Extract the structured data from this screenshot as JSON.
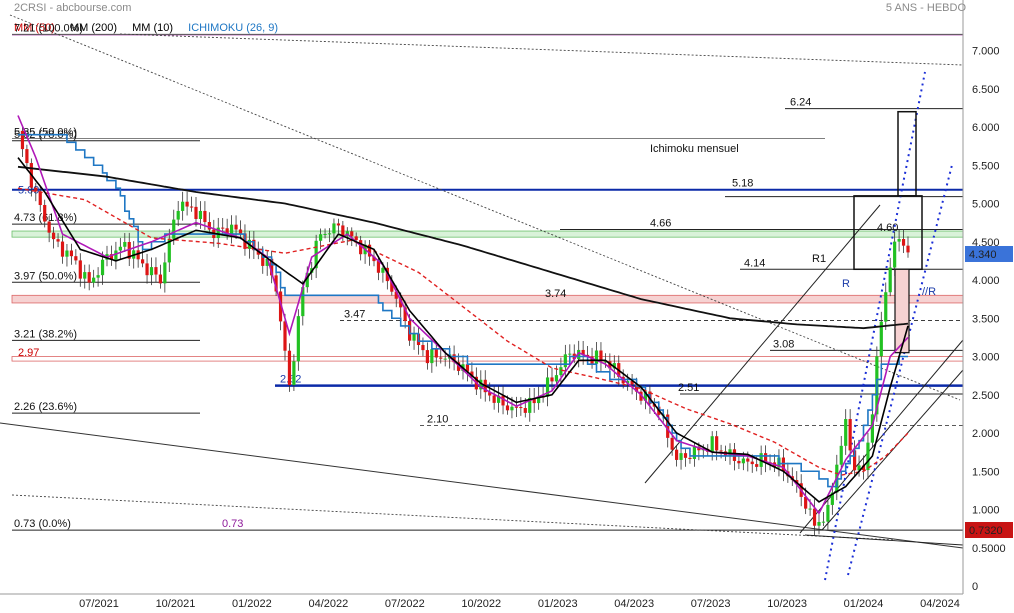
{
  "header": {
    "symbol": "2CRSI - abcbourse.com",
    "period": "5 ANS - HEBDO"
  },
  "legend": {
    "items": [
      {
        "label": "MM (50)",
        "color": "#cc0000"
      },
      {
        "label": "MM (200)",
        "color": "#000000"
      },
      {
        "label": "MM (10)",
        "color": "#000000"
      },
      {
        "label": "ICHIMOKU (26, 9)",
        "color": "#1f77c4"
      }
    ]
  },
  "colors": {
    "up": "#22c122",
    "down": "#dd1515",
    "blue_level": "#0b2aa8",
    "kijun": "#1f77c4",
    "tenkan": "#b018b8"
  },
  "annotations": {
    "ichimoku": "Ichimoku mensuel",
    "r1": "R1",
    "r": "R",
    "parallel_r": "//R"
  },
  "price_labels": {
    "current": "4.340",
    "low": "0.7320"
  },
  "chart_data": {
    "type": "candlestick",
    "x_ticks": [
      "07/2021",
      "10/2021",
      "01/2022",
      "04/2022",
      "07/2022",
      "10/2022",
      "01/2023",
      "04/2023",
      "07/2023",
      "10/2023",
      "01/2024",
      "04/2024"
    ],
    "y_ticks": [
      "0",
      "0.5000",
      "1.000",
      "1.500",
      "2.000",
      "2.500",
      "3.000",
      "3.500",
      "4.000",
      "4.500",
      "5.000",
      "5.500",
      "6.000",
      "6.500",
      "7.000"
    ],
    "ylim": [
      0,
      7.3
    ],
    "last_price": 4.34,
    "low_price": 0.732,
    "fib_levels": [
      {
        "label": "7.21  (100.0%)",
        "value": 7.21
      },
      {
        "label": "5.85  (50.0%)",
        "value": 5.85
      },
      {
        "label": "5.82  (78.6%)",
        "value": 5.82
      },
      {
        "label": "4.73  (61.8%)",
        "value": 4.73
      },
      {
        "label": "3.97  (50.0%)",
        "value": 3.97
      },
      {
        "label": "3.21  (38.2%)",
        "value": 3.21
      },
      {
        "label": "2.26  (23.6%)",
        "value": 2.26
      },
      {
        "label": "0.73  (0.0%)",
        "value": 0.73
      }
    ],
    "levels": [
      {
        "label": "6.24",
        "value": 6.24
      },
      {
        "label": "5.18",
        "value": 5.18
      },
      {
        "label": "5.09",
        "value": 5.09
      },
      {
        "label": "4.66",
        "value": 4.66
      },
      {
        "label": "4.60",
        "value": 4.6
      },
      {
        "label": "4.14",
        "value": 4.14
      },
      {
        "label": "3.74",
        "value": 3.74
      },
      {
        "label": "3.47",
        "value": 3.47
      },
      {
        "label": "3.08",
        "value": 3.08
      },
      {
        "label": "2.97",
        "value": 2.97
      },
      {
        "label": "2.62",
        "value": 2.62
      },
      {
        "label": "2.51",
        "value": 2.51
      },
      {
        "label": "2.10",
        "value": 2.1
      },
      {
        "label": "0.73",
        "value": 0.73
      }
    ],
    "close_keyframes": [
      [
        0,
        5.9
      ],
      [
        4,
        5.1
      ],
      [
        8,
        4.5
      ],
      [
        12,
        4.3
      ],
      [
        16,
        3.95
      ],
      [
        20,
        4.3
      ],
      [
        24,
        4.45
      ],
      [
        28,
        4.2
      ],
      [
        32,
        4.0
      ],
      [
        36,
        5.0
      ],
      [
        40,
        4.9
      ],
      [
        44,
        4.6
      ],
      [
        48,
        4.7
      ],
      [
        52,
        4.45
      ],
      [
        56,
        4.2
      ],
      [
        58,
        3.9
      ],
      [
        61,
        2.6
      ],
      [
        64,
        3.9
      ],
      [
        68,
        4.6
      ],
      [
        72,
        4.7
      ],
      [
        76,
        4.5
      ],
      [
        80,
        4.25
      ],
      [
        84,
        3.9
      ],
      [
        88,
        3.3
      ],
      [
        92,
        3.0
      ],
      [
        96,
        3.0
      ],
      [
        100,
        2.85
      ],
      [
        104,
        2.6
      ],
      [
        108,
        2.4
      ],
      [
        112,
        2.3
      ],
      [
        116,
        2.4
      ],
      [
        120,
        2.7
      ],
      [
        124,
        3.05
      ],
      [
        128,
        3.0
      ],
      [
        132,
        2.95
      ],
      [
        136,
        2.7
      ],
      [
        140,
        2.5
      ],
      [
        144,
        2.3
      ],
      [
        148,
        1.65
      ],
      [
        152,
        1.75
      ],
      [
        156,
        1.85
      ],
      [
        160,
        1.7
      ],
      [
        164,
        1.6
      ],
      [
        168,
        1.65
      ],
      [
        172,
        1.55
      ],
      [
        176,
        1.2
      ],
      [
        179,
        0.8
      ],
      [
        182,
        0.95
      ],
      [
        184,
        1.6
      ],
      [
        186,
        2.1
      ],
      [
        188,
        1.55
      ],
      [
        190,
        1.5
      ],
      [
        192,
        2.3
      ],
      [
        194,
        3.5
      ],
      [
        196,
        4.2
      ],
      [
        198,
        4.6
      ],
      [
        200,
        4.34
      ]
    ],
    "mm200_keyframes": [
      [
        0,
        5.48
      ],
      [
        20,
        5.35
      ],
      [
        40,
        5.15
      ],
      [
        60,
        5.0
      ],
      [
        80,
        4.75
      ],
      [
        100,
        4.45
      ],
      [
        120,
        4.1
      ],
      [
        140,
        3.75
      ],
      [
        160,
        3.5
      ],
      [
        175,
        3.42
      ],
      [
        190,
        3.37
      ],
      [
        200,
        3.43
      ]
    ],
    "mm50_keyframes": [
      [
        0,
        5.2
      ],
      [
        15,
        5.05
      ],
      [
        30,
        4.55
      ],
      [
        45,
        4.48
      ],
      [
        60,
        4.35
      ],
      [
        75,
        4.52
      ],
      [
        90,
        4.1
      ],
      [
        100,
        3.65
      ],
      [
        110,
        3.2
      ],
      [
        120,
        2.85
      ],
      [
        130,
        2.72
      ],
      [
        140,
        2.58
      ],
      [
        150,
        2.32
      ],
      [
        160,
        2.12
      ],
      [
        170,
        1.88
      ],
      [
        180,
        1.55
      ],
      [
        185,
        1.45
      ],
      [
        190,
        1.5
      ],
      [
        195,
        1.7
      ],
      [
        200,
        2.0
      ]
    ],
    "kijun_keyframes": [
      [
        0,
        5.85
      ],
      [
        10,
        5.85
      ],
      [
        16,
        5.6
      ],
      [
        22,
        5.2
      ],
      [
        28,
        4.4
      ],
      [
        34,
        4.6
      ],
      [
        40,
        4.6
      ],
      [
        50,
        4.55
      ],
      [
        56,
        4.3
      ],
      [
        60,
        3.8
      ],
      [
        70,
        3.8
      ],
      [
        80,
        3.75
      ],
      [
        90,
        3.2
      ],
      [
        100,
        2.95
      ],
      [
        110,
        2.85
      ],
      [
        120,
        2.85
      ],
      [
        126,
        3.0
      ],
      [
        132,
        2.75
      ],
      [
        140,
        2.62
      ],
      [
        150,
        1.75
      ],
      [
        160,
        1.72
      ],
      [
        170,
        1.65
      ],
      [
        178,
        1.5
      ],
      [
        183,
        1.3
      ],
      [
        188,
        1.75
      ],
      [
        194,
        2.85
      ],
      [
        200,
        3.0
      ]
    ],
    "tenkan_keyframes": [
      [
        0,
        6.15
      ],
      [
        4,
        5.6
      ],
      [
        10,
        4.6
      ],
      [
        20,
        4.3
      ],
      [
        30,
        4.5
      ],
      [
        40,
        4.75
      ],
      [
        50,
        4.55
      ],
      [
        56,
        4.3
      ],
      [
        61,
        3.3
      ],
      [
        66,
        4.3
      ],
      [
        74,
        4.6
      ],
      [
        82,
        4.2
      ],
      [
        88,
        3.5
      ],
      [
        96,
        3.05
      ],
      [
        104,
        2.6
      ],
      [
        112,
        2.35
      ],
      [
        120,
        2.55
      ],
      [
        126,
        3.05
      ],
      [
        132,
        2.9
      ],
      [
        140,
        2.5
      ],
      [
        148,
        1.9
      ],
      [
        156,
        1.75
      ],
      [
        164,
        1.7
      ],
      [
        172,
        1.55
      ],
      [
        180,
        0.95
      ],
      [
        186,
        1.65
      ],
      [
        192,
        2.1
      ],
      [
        196,
        3.0
      ],
      [
        200,
        3.25
      ]
    ],
    "mm10_keyframes": [
      [
        0,
        5.6
      ],
      [
        6,
        5.15
      ],
      [
        14,
        4.4
      ],
      [
        22,
        4.25
      ],
      [
        30,
        4.4
      ],
      [
        40,
        4.65
      ],
      [
        50,
        4.55
      ],
      [
        58,
        4.2
      ],
      [
        64,
        3.95
      ],
      [
        72,
        4.6
      ],
      [
        80,
        4.4
      ],
      [
        88,
        3.6
      ],
      [
        96,
        3.05
      ],
      [
        104,
        2.65
      ],
      [
        112,
        2.4
      ],
      [
        120,
        2.5
      ],
      [
        126,
        2.95
      ],
      [
        132,
        2.95
      ],
      [
        140,
        2.6
      ],
      [
        148,
        2.0
      ],
      [
        156,
        1.75
      ],
      [
        164,
        1.72
      ],
      [
        172,
        1.5
      ],
      [
        180,
        1.1
      ],
      [
        186,
        1.3
      ],
      [
        192,
        1.7
      ],
      [
        196,
        2.6
      ],
      [
        200,
        3.4
      ]
    ]
  }
}
